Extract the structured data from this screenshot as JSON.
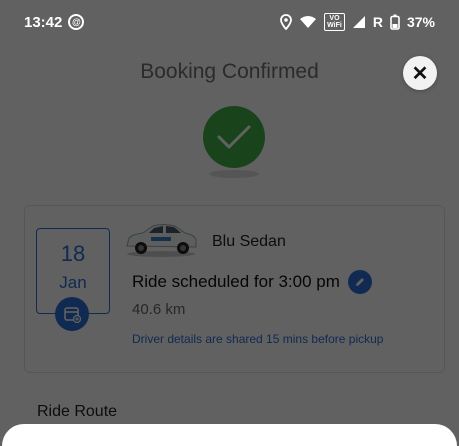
{
  "status_bar": {
    "time": "13:42",
    "network_label": "R",
    "battery": "37%",
    "volte_top": "VO",
    "volte_bottom": "WiFi"
  },
  "header": {
    "title": "Booking Confirmed",
    "close_label": "✕"
  },
  "booking": {
    "date_day": "18",
    "date_month": "Jan",
    "car_name": "Blu Sedan",
    "ride_time": "Ride scheduled for 3:00 pm",
    "distance": "40.6 km",
    "driver_note": "Driver details are shared 15 mins before pickup"
  },
  "route": {
    "title": "Ride Route"
  },
  "colors": {
    "accent": "#2f6fd6",
    "success": "#43b049",
    "scrim": "rgba(0,0,0,0.62)"
  }
}
